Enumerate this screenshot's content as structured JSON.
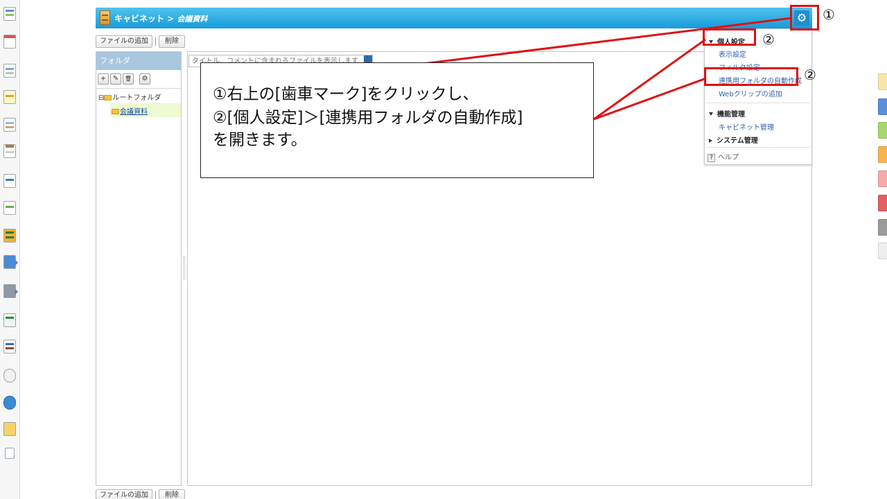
{
  "window": {
    "app_name": "キャビネット",
    "breadcrumb_sep": " > ",
    "current_folder": "会議資料"
  },
  "toolbar": {
    "add_file_label": "ファイルの追加",
    "delete_label": "削除"
  },
  "folder_panel": {
    "header": "フォルダ",
    "tools": [
      "+",
      "✎",
      "🗑",
      "⚙"
    ],
    "tree": [
      {
        "toggle": "⊟",
        "label": "ルートフォルダ"
      },
      {
        "label": "会議資料",
        "selected": true
      }
    ]
  },
  "search": {
    "placeholder": "タイトル、コメントに含まれるファイルを表示します"
  },
  "settings_menu": {
    "personal": {
      "title": "個人設定",
      "items": [
        "表示設定",
        "フィルタ設定",
        "連携用フォルダの自動作成",
        "Webクリップの追加"
      ]
    },
    "function": {
      "title": "機能管理",
      "items": [
        "キャビネット管理"
      ]
    },
    "system": {
      "title": "システム管理"
    },
    "help": "ヘルプ"
  },
  "annotations": {
    "markers": [
      "①",
      "②",
      "②"
    ],
    "callout_lines": [
      "①右上の[歯車マーク]をクリックし、",
      "②[個人設定]＞[連携用フォルダの自動作成]",
      "を開きます。"
    ],
    "highlight_color": "#E01010"
  },
  "theme": {
    "title_bar": "#189BD8",
    "folder_header": "#A9C6DF",
    "selected_folder": "#EEFAD2",
    "link": "#3060A8"
  }
}
